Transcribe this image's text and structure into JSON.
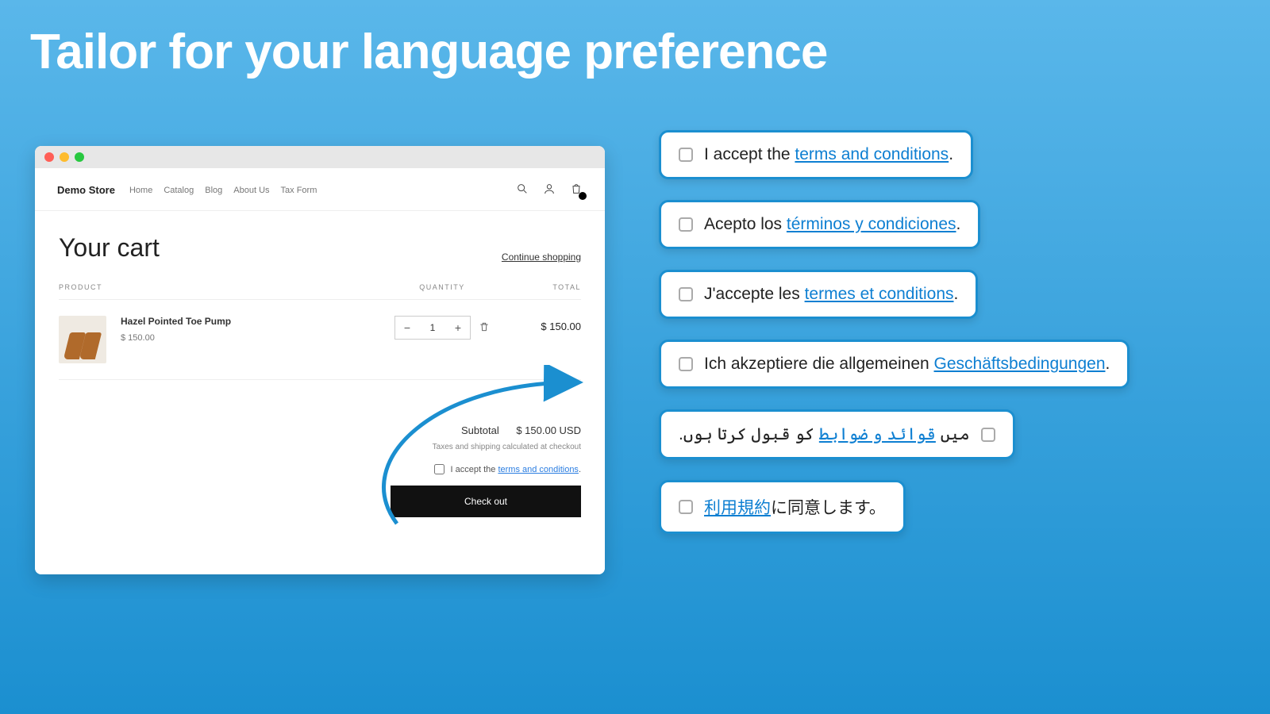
{
  "headline": "Tailor for your language preference",
  "browser": {
    "store_name": "Demo Store",
    "nav": [
      "Home",
      "Catalog",
      "Blog",
      "About Us",
      "Tax Form"
    ],
    "cart_title": "Your cart",
    "continue_shopping": "Continue shopping",
    "cols": {
      "product": "PRODUCT",
      "quantity": "QUANTITY",
      "total": "TOTAL"
    },
    "item": {
      "name": "Hazel Pointed Toe Pump",
      "price": "$ 150.00",
      "qty": "1",
      "line_total": "$ 150.00"
    },
    "subtotal_label": "Subtotal",
    "subtotal_value": "$ 150.00 USD",
    "tax_note": "Taxes and shipping calculated at checkout",
    "terms_prefix": "I accept the ",
    "terms_link": "terms and conditions",
    "terms_suffix": ".",
    "checkout": "Check out"
  },
  "cards": [
    {
      "prefix": "I accept the ",
      "link": "terms and conditions",
      "suffix": "."
    },
    {
      "prefix": "Acepto los ",
      "link": "términos y condiciones",
      "suffix": "."
    },
    {
      "prefix": "J'accepte les ",
      "link": "termes et conditions",
      "suffix": "."
    },
    {
      "prefix": "Ich akzeptiere die allgemeinen ",
      "link": "Geschäftsbedingungen",
      "suffix": "."
    },
    {
      "prefix": "میں ",
      "link": "قوائد و ضوابط",
      "suffix": " کو قبول کرتا ہوں.",
      "rtl": true
    },
    {
      "prefix": "",
      "link": "利用規約",
      "suffix": "に同意します。"
    }
  ]
}
